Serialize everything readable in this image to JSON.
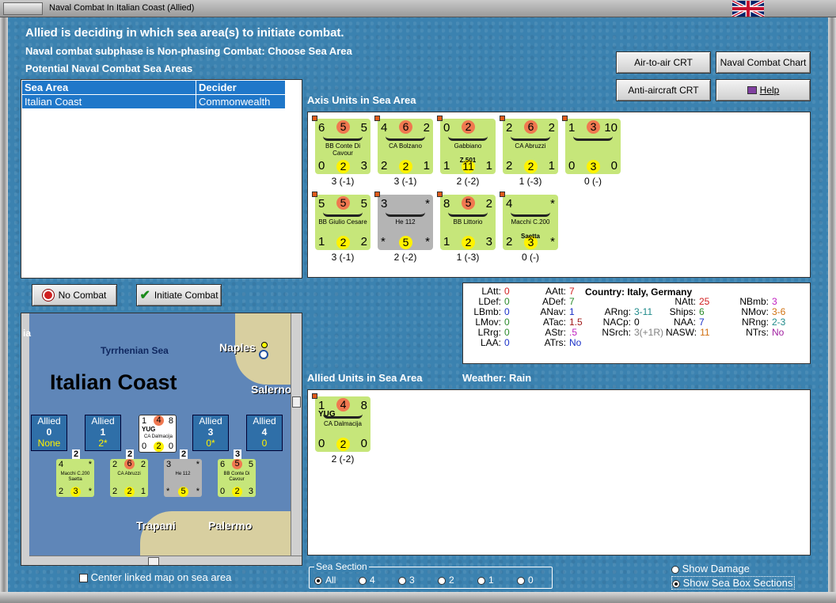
{
  "window": {
    "title": "Naval Combat In Italian Coast (Allied)"
  },
  "header": {
    "line1": "Allied is deciding in which sea area(s) to initiate combat.",
    "line2": "Naval combat subphase is Non-phasing Combat: Choose Sea Area",
    "line3": "Potential Naval Combat Sea Areas"
  },
  "buttons": {
    "air_to_air": "Air-to-air CRT",
    "naval_chart": "Naval Combat Chart",
    "anti_aircraft": "Anti-aircraft CRT",
    "help": "Help",
    "no_combat": "No Combat",
    "initiate_combat": "Initiate Combat"
  },
  "sea_table": {
    "headers": [
      "Sea Area",
      "Decider"
    ],
    "rows": [
      [
        "Italian Coast",
        "Commonwealth"
      ]
    ]
  },
  "axis": {
    "label": "Axis Units in Sea Area",
    "units": [
      {
        "tl": "6",
        "tc": "5",
        "tr": "5",
        "bl": "0",
        "bc": "2",
        "br": "3",
        "name": "BB Conte Di Cavour",
        "status": "3 (-1)"
      },
      {
        "tl": "4",
        "tc": "6",
        "tr": "2",
        "bl": "2",
        "bc": "2",
        "br": "1",
        "name": "CA Bolzano",
        "status": "3 (-1)"
      },
      {
        "tl": "0",
        "tc": "2",
        "tr": "",
        "bl": "1",
        "bc": "11",
        "br": "1",
        "name": "Gabbiano",
        "sub": "Z.501",
        "status": "2 (-2)"
      },
      {
        "tl": "2",
        "tc": "6",
        "tr": "2",
        "bl": "2",
        "bc": "2",
        "br": "1",
        "name": "CA Abruzzi",
        "status": "1 (-3)"
      },
      {
        "tl": "1",
        "tc": "3",
        "tr": "10",
        "bl": "0",
        "bc": "3",
        "br": "0",
        "name": "",
        "status": "0 (-)"
      },
      {
        "tl": "5",
        "tc": "5",
        "tr": "5",
        "bl": "1",
        "bc": "2",
        "br": "2",
        "name": "BB Giulio Cesare",
        "status": "3 (-1)"
      },
      {
        "tl": "3",
        "tc": "",
        "tr": "*",
        "bl": "*",
        "bc": "5",
        "br": "*",
        "name": "He 112",
        "status": "2 (-2)"
      },
      {
        "tl": "8",
        "tc": "5",
        "tr": "2",
        "bl": "1",
        "bc": "2",
        "br": "3",
        "name": "BB Littorio",
        "status": "1 (-3)"
      },
      {
        "tl": "4",
        "tc": "",
        "tr": "*",
        "bl": "2",
        "bc": "3",
        "br": "*",
        "name": "Macchi C.200",
        "sub": "Saetta",
        "status": "0 (-)"
      }
    ]
  },
  "stats": {
    "country_label": "Country:",
    "country": "Italy, Germany",
    "col1": [
      [
        "LAtt:",
        "0"
      ],
      [
        "LDef:",
        "0"
      ],
      [
        "LBmb:",
        "0"
      ],
      [
        "LMov:",
        "0"
      ],
      [
        "LRrg:",
        "0"
      ],
      [
        "LAA:",
        "0"
      ]
    ],
    "col2": [
      [
        "AAtt:",
        "7"
      ],
      [
        "ADef:",
        "7"
      ],
      [
        "ANav:",
        "1"
      ],
      [
        "ATac:",
        "1.5"
      ],
      [
        "AStr:",
        ".5"
      ],
      [
        "ATrs:",
        "No"
      ]
    ],
    "col3": [
      [
        "ARng:",
        "3-11"
      ],
      [
        "NACp:",
        "0"
      ],
      [
        "NSrch:",
        "3(+1R)"
      ]
    ],
    "col4": [
      [
        "NAtt:",
        "25"
      ],
      [
        "Ships:",
        "6"
      ],
      [
        "NAA:",
        "7"
      ],
      [
        "NASW:",
        "11"
      ]
    ],
    "col5": [
      [
        "NBmb:",
        "3"
      ],
      [
        "NMov:",
        "3-6"
      ],
      [
        "NRng:",
        "2-3"
      ],
      [
        "NTrs:",
        "No"
      ]
    ]
  },
  "allied": {
    "label": "Allied Units in Sea Area",
    "weather_label": "Weather:",
    "weather": "Rain",
    "units": [
      {
        "tl": "1",
        "tc": "4",
        "tr": "8",
        "bl": "0",
        "bc": "2",
        "br": "0",
        "nation": "YUG",
        "name": "CA Dalmacija",
        "status": "2 (-2)"
      }
    ]
  },
  "map": {
    "sea_name": "Tyrrhenian Sea",
    "area_name": "Italian Coast",
    "cities": [
      "Naples",
      "Salerno",
      "Trapani",
      "Palermo"
    ],
    "boxes": [
      {
        "side": "Allied",
        "num": "0",
        "sub": "None"
      },
      {
        "side": "Allied",
        "num": "1",
        "sub": "2*"
      },
      {
        "side": "Allied",
        "num": "3",
        "sub": "0*"
      },
      {
        "side": "Allied",
        "num": "4",
        "sub": "0"
      }
    ],
    "left_label": "ia",
    "mini_units": [
      {
        "tl": "4",
        "tc": "",
        "tr": "*",
        "bl": "2",
        "bc": "3",
        "br": "*",
        "name": "Macchi C.200 Saetta",
        "count": "2"
      },
      {
        "tl": "2",
        "tc": "6",
        "tr": "2",
        "bl": "2",
        "bc": "2",
        "br": "1",
        "name": "CA Abruzzi",
        "count": "2"
      },
      {
        "tl": "3",
        "tc": "",
        "tr": "*",
        "bl": "*",
        "bc": "5",
        "br": "*",
        "name": "He 112",
        "count": "2"
      },
      {
        "tl": "6",
        "tc": "5",
        "tr": "5",
        "bl": "0",
        "bc": "2",
        "br": "3",
        "name": "BB Conte Di Cavour",
        "count": "3"
      }
    ],
    "top_counter": {
      "tl": "1",
      "tc": "4",
      "tr": "8",
      "bl": "0",
      "bc": "2",
      "br": "0",
      "nation": "YUG",
      "name": "CA Dalmacija"
    }
  },
  "center_map": {
    "label": "Center linked map on sea area"
  },
  "sea_section": {
    "label": "Sea Section",
    "options": [
      "All",
      "4",
      "3",
      "2",
      "1",
      "0"
    ]
  },
  "show": {
    "damage": "Show Damage",
    "sections": "Show Sea Box Sections"
  },
  "colors": {
    "accent": "#1f77c9",
    "counter": "#c6e67a",
    "attack": "#f07850",
    "defense": "#fff200"
  }
}
